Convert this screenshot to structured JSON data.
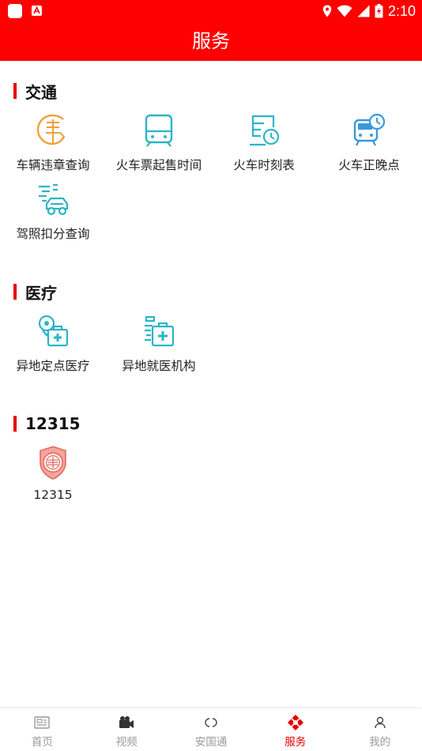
{
  "status_bar": {
    "time": "2:10"
  },
  "header": {
    "title": "服务"
  },
  "sections": [
    {
      "title": "交通",
      "items": [
        {
          "label": "车辆违章查询"
        },
        {
          "label": "火车票起售时间"
        },
        {
          "label": "火车时刻表"
        },
        {
          "label": "火车正晚点"
        },
        {
          "label": "驾照扣分查询"
        }
      ]
    },
    {
      "title": "医疗",
      "items": [
        {
          "label": "异地定点医疗"
        },
        {
          "label": "异地就医机构"
        }
      ]
    },
    {
      "title": "12315",
      "items": [
        {
          "label": "12315"
        }
      ]
    }
  ],
  "tabbar": {
    "items": [
      {
        "label": "首页"
      },
      {
        "label": "视频"
      },
      {
        "label": "安国通"
      },
      {
        "label": "服务"
      },
      {
        "label": "我的"
      }
    ],
    "active_index": 3
  },
  "colors": {
    "brand": "#ff0000",
    "accent_teal": "#2ab5c8",
    "accent_blue": "#3a98dc",
    "accent_orange": "#f0a040"
  },
  "icons": [
    "violation-icon",
    "ticket-sale-icon",
    "train-schedule-icon",
    "train-delay-icon",
    "license-points-icon",
    "designated-medical-icon",
    "medical-institution-icon",
    "consumer-badge-icon"
  ]
}
